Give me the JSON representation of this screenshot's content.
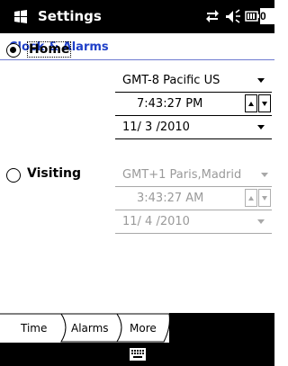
{
  "titlebar": {
    "title": "Settings",
    "clock_partial": "0",
    "icons": [
      "windows-start-icon",
      "connectivity-icon",
      "volume-icon",
      "battery-icon"
    ]
  },
  "page": {
    "title": "Clock & Alarms"
  },
  "home": {
    "label": "Home",
    "selected": true,
    "timezone": "GMT-8 Pacific US",
    "time": "7:43:27 PM",
    "date": "11/ 3 /2010"
  },
  "visiting": {
    "label": "Visiting",
    "selected": false,
    "timezone": "GMT+1 Paris,Madrid",
    "time": "3:43:27 AM",
    "date": "11/ 4 /2010"
  },
  "tabs": [
    {
      "label": "Time",
      "active": true
    },
    {
      "label": "Alarms",
      "active": false
    },
    {
      "label": "More",
      "active": false
    }
  ],
  "bottombar": {
    "icons": [
      "keyboard-icon"
    ]
  },
  "colors": {
    "header": "#1f40c8",
    "bar": "#000000",
    "disabled": "#9a9a9a"
  }
}
